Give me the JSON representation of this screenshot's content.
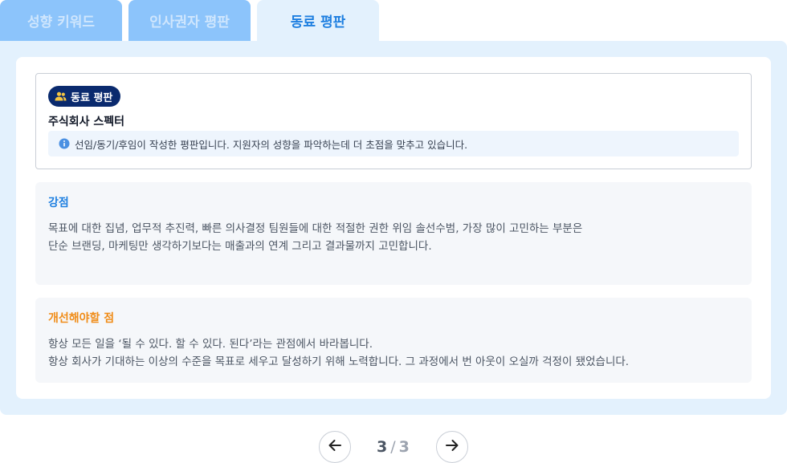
{
  "tabs": [
    {
      "label": "성향 키워드",
      "active": false
    },
    {
      "label": "인사권자 평판",
      "active": false
    },
    {
      "label": "동료 평판",
      "active": true
    }
  ],
  "card": {
    "badge_label": "동료 평판",
    "badge_icon": "users-icon",
    "company": "주식회사 스펙터",
    "notice_icon": "info-icon",
    "notice": "선임/동기/후임이 작성한 평판입니다. 지원자의 성향을 파악하는데 더 초점을 맞추고 있습니다."
  },
  "strength": {
    "title": "강점",
    "lines": [
      "목표에 대한 집념, 업무적 추진력, 빠른 의사결정 팀원들에 대한 적절한 권한 위임 솔선수범, 가장 많이 고민하는 부분은",
      "단순 브랜딩, 마케팅만 생각하기보다는 매출과의 연계 그리고 결과물까지 고민합니다."
    ]
  },
  "improve": {
    "title": "개선해야할 점",
    "lines": [
      "항상 모든 일을 ‘될 수 있다. 할 수 있다. 된다’라는 관점에서 바라봅니다.",
      "항상 회사가 기대하는 이상의 수준을 목표로 세우고 달성하기 위해 노력합니다. 그 과정에서 번 아웃이 오실까 걱정이 됐었습니다."
    ]
  },
  "pagination": {
    "current": "3",
    "separator": "/",
    "total": "3",
    "prev_icon": "arrow-left-icon",
    "next_icon": "arrow-right-icon"
  },
  "colors": {
    "tab_inactive": "#8cc4fb",
    "tab_active_bg": "#e3f1fd",
    "accent_blue": "#1e7fe0",
    "accent_orange": "#f08c17",
    "badge_bg": "#0a2a6e"
  }
}
